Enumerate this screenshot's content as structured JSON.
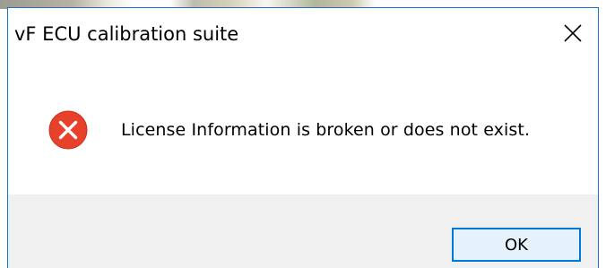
{
  "dialog": {
    "title": "vF ECU calibration suite",
    "close_icon": "close-icon",
    "icon": "error-icon",
    "message": "License Information is broken or does not exist.",
    "ok_label": "OK"
  },
  "colors": {
    "accent_border": "#0078d7",
    "window_border": "#1e73c8",
    "error_red": "#e8412b",
    "footer_bg": "#f0f0f0",
    "button_bg": "#e5f1fb"
  }
}
